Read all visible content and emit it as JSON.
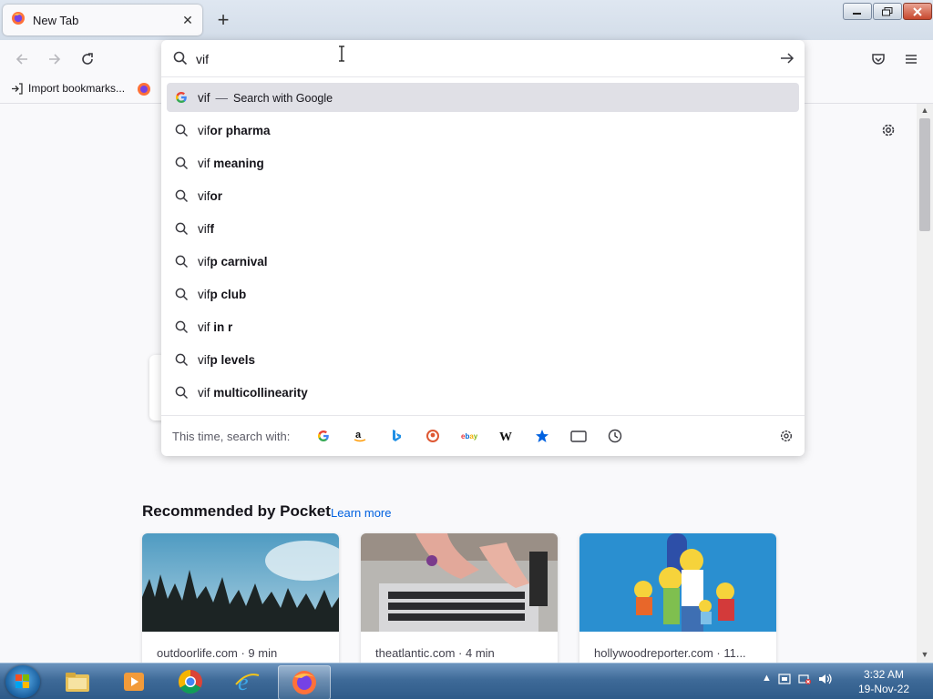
{
  "browser": {
    "tab": {
      "title": "New Tab"
    },
    "bookmarks_bar": {
      "import_label": "Import bookmarks..."
    }
  },
  "urlbar": {
    "typed": "vif",
    "suggestions": [
      {
        "prefix": "vif",
        "bold": "",
        "suffix": "Search with Google",
        "engine": true
      },
      {
        "prefix": "vif",
        "bold": "or pharma"
      },
      {
        "prefix": "vif",
        "bold": " meaning"
      },
      {
        "prefix": "vif",
        "bold": "or"
      },
      {
        "prefix": "vif",
        "bold": "f"
      },
      {
        "prefix": "vif",
        "bold": "p carnival"
      },
      {
        "prefix": "vif",
        "bold": "p club"
      },
      {
        "prefix": "vif",
        "bold": " in r"
      },
      {
        "prefix": "vif",
        "bold": "p levels"
      },
      {
        "prefix": "vif",
        "bold": " multicollinearity"
      }
    ],
    "separator": "—",
    "oneoff_label": "This time, search with:",
    "engines": [
      "google",
      "amazon",
      "bing",
      "duckduckgo",
      "ebay",
      "wikipedia",
      "bookmarks",
      "tabs",
      "history"
    ]
  },
  "pocket": {
    "title": "Recommended by Pocket",
    "learn_more": "Learn more",
    "cards": [
      {
        "source": "outdoorlife.com · 9 min"
      },
      {
        "source": "theatlantic.com · 4 min"
      },
      {
        "source": "hollywoodreporter.com · 11..."
      }
    ]
  },
  "taskbar": {
    "time": "3:32 AM",
    "date": "19-Nov-22"
  },
  "colors": {
    "accent": "#0061e0",
    "selected_row": "#e0e0e6"
  }
}
